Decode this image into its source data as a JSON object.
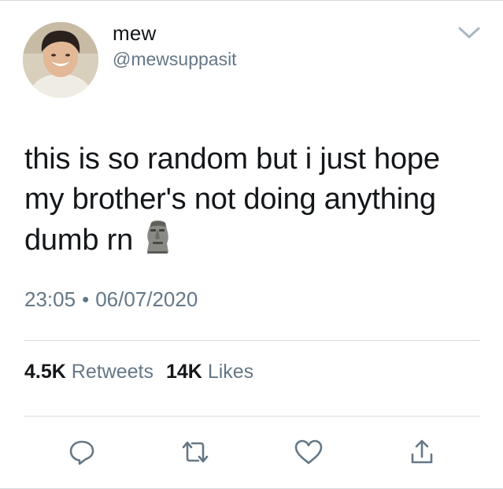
{
  "tweet": {
    "display_name": "mew",
    "handle": "@mewsuppasit",
    "text": "this is so random but i just hope my brother's not doing anything dumb rn",
    "emoji": "moai",
    "time": "23:05",
    "separator": "•",
    "date": "06/07/2020"
  },
  "stats": {
    "retweets_count": "4.5K",
    "retweets_label": "Retweets",
    "likes_count": "14K",
    "likes_label": "Likes"
  },
  "actions": [
    "reply-icon",
    "retweet-icon",
    "like-icon",
    "share-icon"
  ],
  "colors": {
    "text": "#14171a",
    "secondary": "#657786",
    "divider": "#d7dadd",
    "icon": "#657786"
  }
}
